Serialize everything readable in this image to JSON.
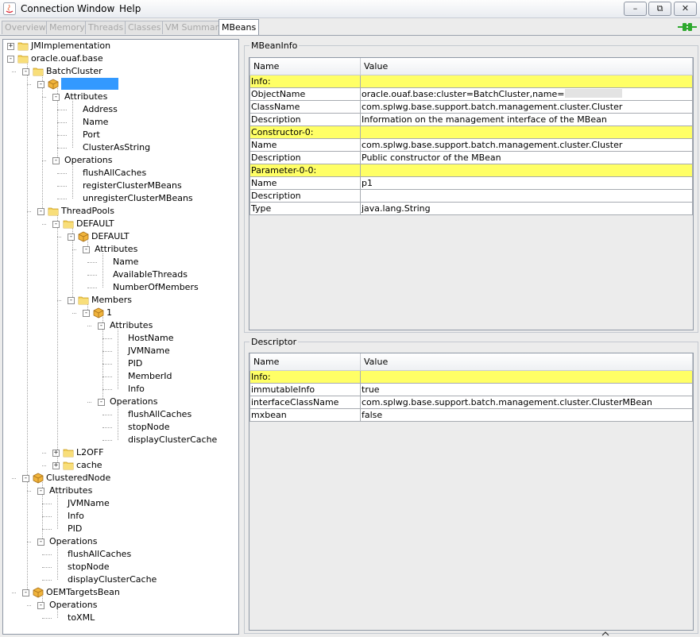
{
  "menu": {
    "items": [
      "Connection",
      "Window",
      "Help"
    ],
    "window_buttons": [
      "–",
      "⧉",
      "✕"
    ]
  },
  "tabs": [
    {
      "label": "Overview",
      "enabled": false
    },
    {
      "label": "Memory",
      "enabled": false
    },
    {
      "label": "Threads",
      "enabled": false
    },
    {
      "label": "Classes",
      "enabled": false
    },
    {
      "label": "VM Summary",
      "enabled": false
    },
    {
      "label": "MBeans",
      "enabled": true,
      "active": true
    }
  ],
  "colors": {
    "selection": "#3399ff",
    "section_row": "#ffff66",
    "connected": "#2ea82e"
  },
  "tree": [
    {
      "label": "JMImplementation",
      "level": 0,
      "icon": "folder-icon",
      "expander": "+"
    },
    {
      "label": "oracle.ouaf.base",
      "level": 0,
      "icon": "folder-icon",
      "expander": "-"
    },
    {
      "label": "BatchCluster",
      "level": 1,
      "icon": "folder-icon",
      "expander": "-"
    },
    {
      "label": "",
      "level": 2,
      "icon": "bean-icon",
      "expander": "-",
      "selected": true
    },
    {
      "label": "Attributes",
      "level": 3,
      "expander": "-"
    },
    {
      "label": "Address",
      "level": 4
    },
    {
      "label": "Name",
      "level": 4
    },
    {
      "label": "Port",
      "level": 4
    },
    {
      "label": "ClusterAsString",
      "level": 4
    },
    {
      "label": "Operations",
      "level": 3,
      "expander": "-"
    },
    {
      "label": "flushAllCaches",
      "level": 4
    },
    {
      "label": "registerClusterMBeans",
      "level": 4
    },
    {
      "label": "unregisterClusterMBeans",
      "level": 4
    },
    {
      "label": "ThreadPools",
      "level": 2,
      "icon": "folder-icon",
      "expander": "-"
    },
    {
      "label": "DEFAULT",
      "level": 3,
      "icon": "folder-icon",
      "expander": "-"
    },
    {
      "label": "DEFAULT",
      "level": 4,
      "icon": "bean-icon",
      "expander": "-"
    },
    {
      "label": "Attributes",
      "level": 5,
      "expander": "-"
    },
    {
      "label": "Name",
      "level": 6
    },
    {
      "label": "AvailableThreads",
      "level": 6
    },
    {
      "label": "NumberOfMembers",
      "level": 6
    },
    {
      "label": "Members",
      "level": 4,
      "icon": "folder-icon",
      "expander": "-"
    },
    {
      "label": "1",
      "level": 5,
      "icon": "bean-icon",
      "expander": "-"
    },
    {
      "label": "Attributes",
      "level": 6,
      "expander": "-"
    },
    {
      "label": "HostName",
      "level": 7
    },
    {
      "label": "JVMName",
      "level": 7
    },
    {
      "label": "PID",
      "level": 7
    },
    {
      "label": "MemberId",
      "level": 7
    },
    {
      "label": "Info",
      "level": 7
    },
    {
      "label": "Operations",
      "level": 6,
      "expander": "-"
    },
    {
      "label": "flushAllCaches",
      "level": 7
    },
    {
      "label": "stopNode",
      "level": 7
    },
    {
      "label": "displayClusterCache",
      "level": 7
    },
    {
      "label": "L2OFF",
      "level": 3,
      "icon": "folder-icon",
      "expander": "+"
    },
    {
      "label": "cache",
      "level": 3,
      "icon": "folder-icon",
      "expander": "+"
    },
    {
      "label": "ClusteredNode",
      "level": 1,
      "icon": "bean-icon",
      "expander": "-"
    },
    {
      "label": "Attributes",
      "level": 2,
      "expander": "-"
    },
    {
      "label": "JVMName",
      "level": 3
    },
    {
      "label": "Info",
      "level": 3
    },
    {
      "label": "PID",
      "level": 3
    },
    {
      "label": "Operations",
      "level": 2,
      "expander": "-"
    },
    {
      "label": "flushAllCaches",
      "level": 3
    },
    {
      "label": "stopNode",
      "level": 3
    },
    {
      "label": "displayClusterCache",
      "level": 3
    },
    {
      "label": "OEMTargetsBean",
      "level": 1,
      "icon": "bean-icon",
      "expander": "-"
    },
    {
      "label": "Operations",
      "level": 2,
      "expander": "-"
    },
    {
      "label": "toXML",
      "level": 3
    }
  ],
  "mbeaninfo": {
    "title": "MBeanInfo",
    "columns": [
      "Name",
      "Value"
    ],
    "rows": [
      {
        "name": "Info:",
        "value": "",
        "header": true
      },
      {
        "name": "ObjectName",
        "value": "oracle.ouaf.base:cluster=BatchCluster,name=",
        "redacted": true
      },
      {
        "name": "ClassName",
        "value": "com.splwg.base.support.batch.management.cluster.Cluster"
      },
      {
        "name": "Description",
        "value": "Information on the management interface of the MBean"
      },
      {
        "name": "Constructor-0:",
        "value": "",
        "header": true
      },
      {
        "name": "Name",
        "value": "com.splwg.base.support.batch.management.cluster.Cluster"
      },
      {
        "name": "Description",
        "value": "Public constructor of the MBean"
      },
      {
        "name": "Parameter-0-0:",
        "value": "",
        "header": true
      },
      {
        "name": "Name",
        "value": "p1"
      },
      {
        "name": "Description",
        "value": ""
      },
      {
        "name": "Type",
        "value": "java.lang.String"
      }
    ]
  },
  "descriptor": {
    "title": "Descriptor",
    "columns": [
      "Name",
      "Value"
    ],
    "rows": [
      {
        "name": "Info:",
        "value": "",
        "header": true
      },
      {
        "name": "immutableInfo",
        "value": "true"
      },
      {
        "name": "interfaceClassName",
        "value": "com.splwg.base.support.batch.management.cluster.ClusterMBean"
      },
      {
        "name": "mxbean",
        "value": "false"
      }
    ]
  }
}
